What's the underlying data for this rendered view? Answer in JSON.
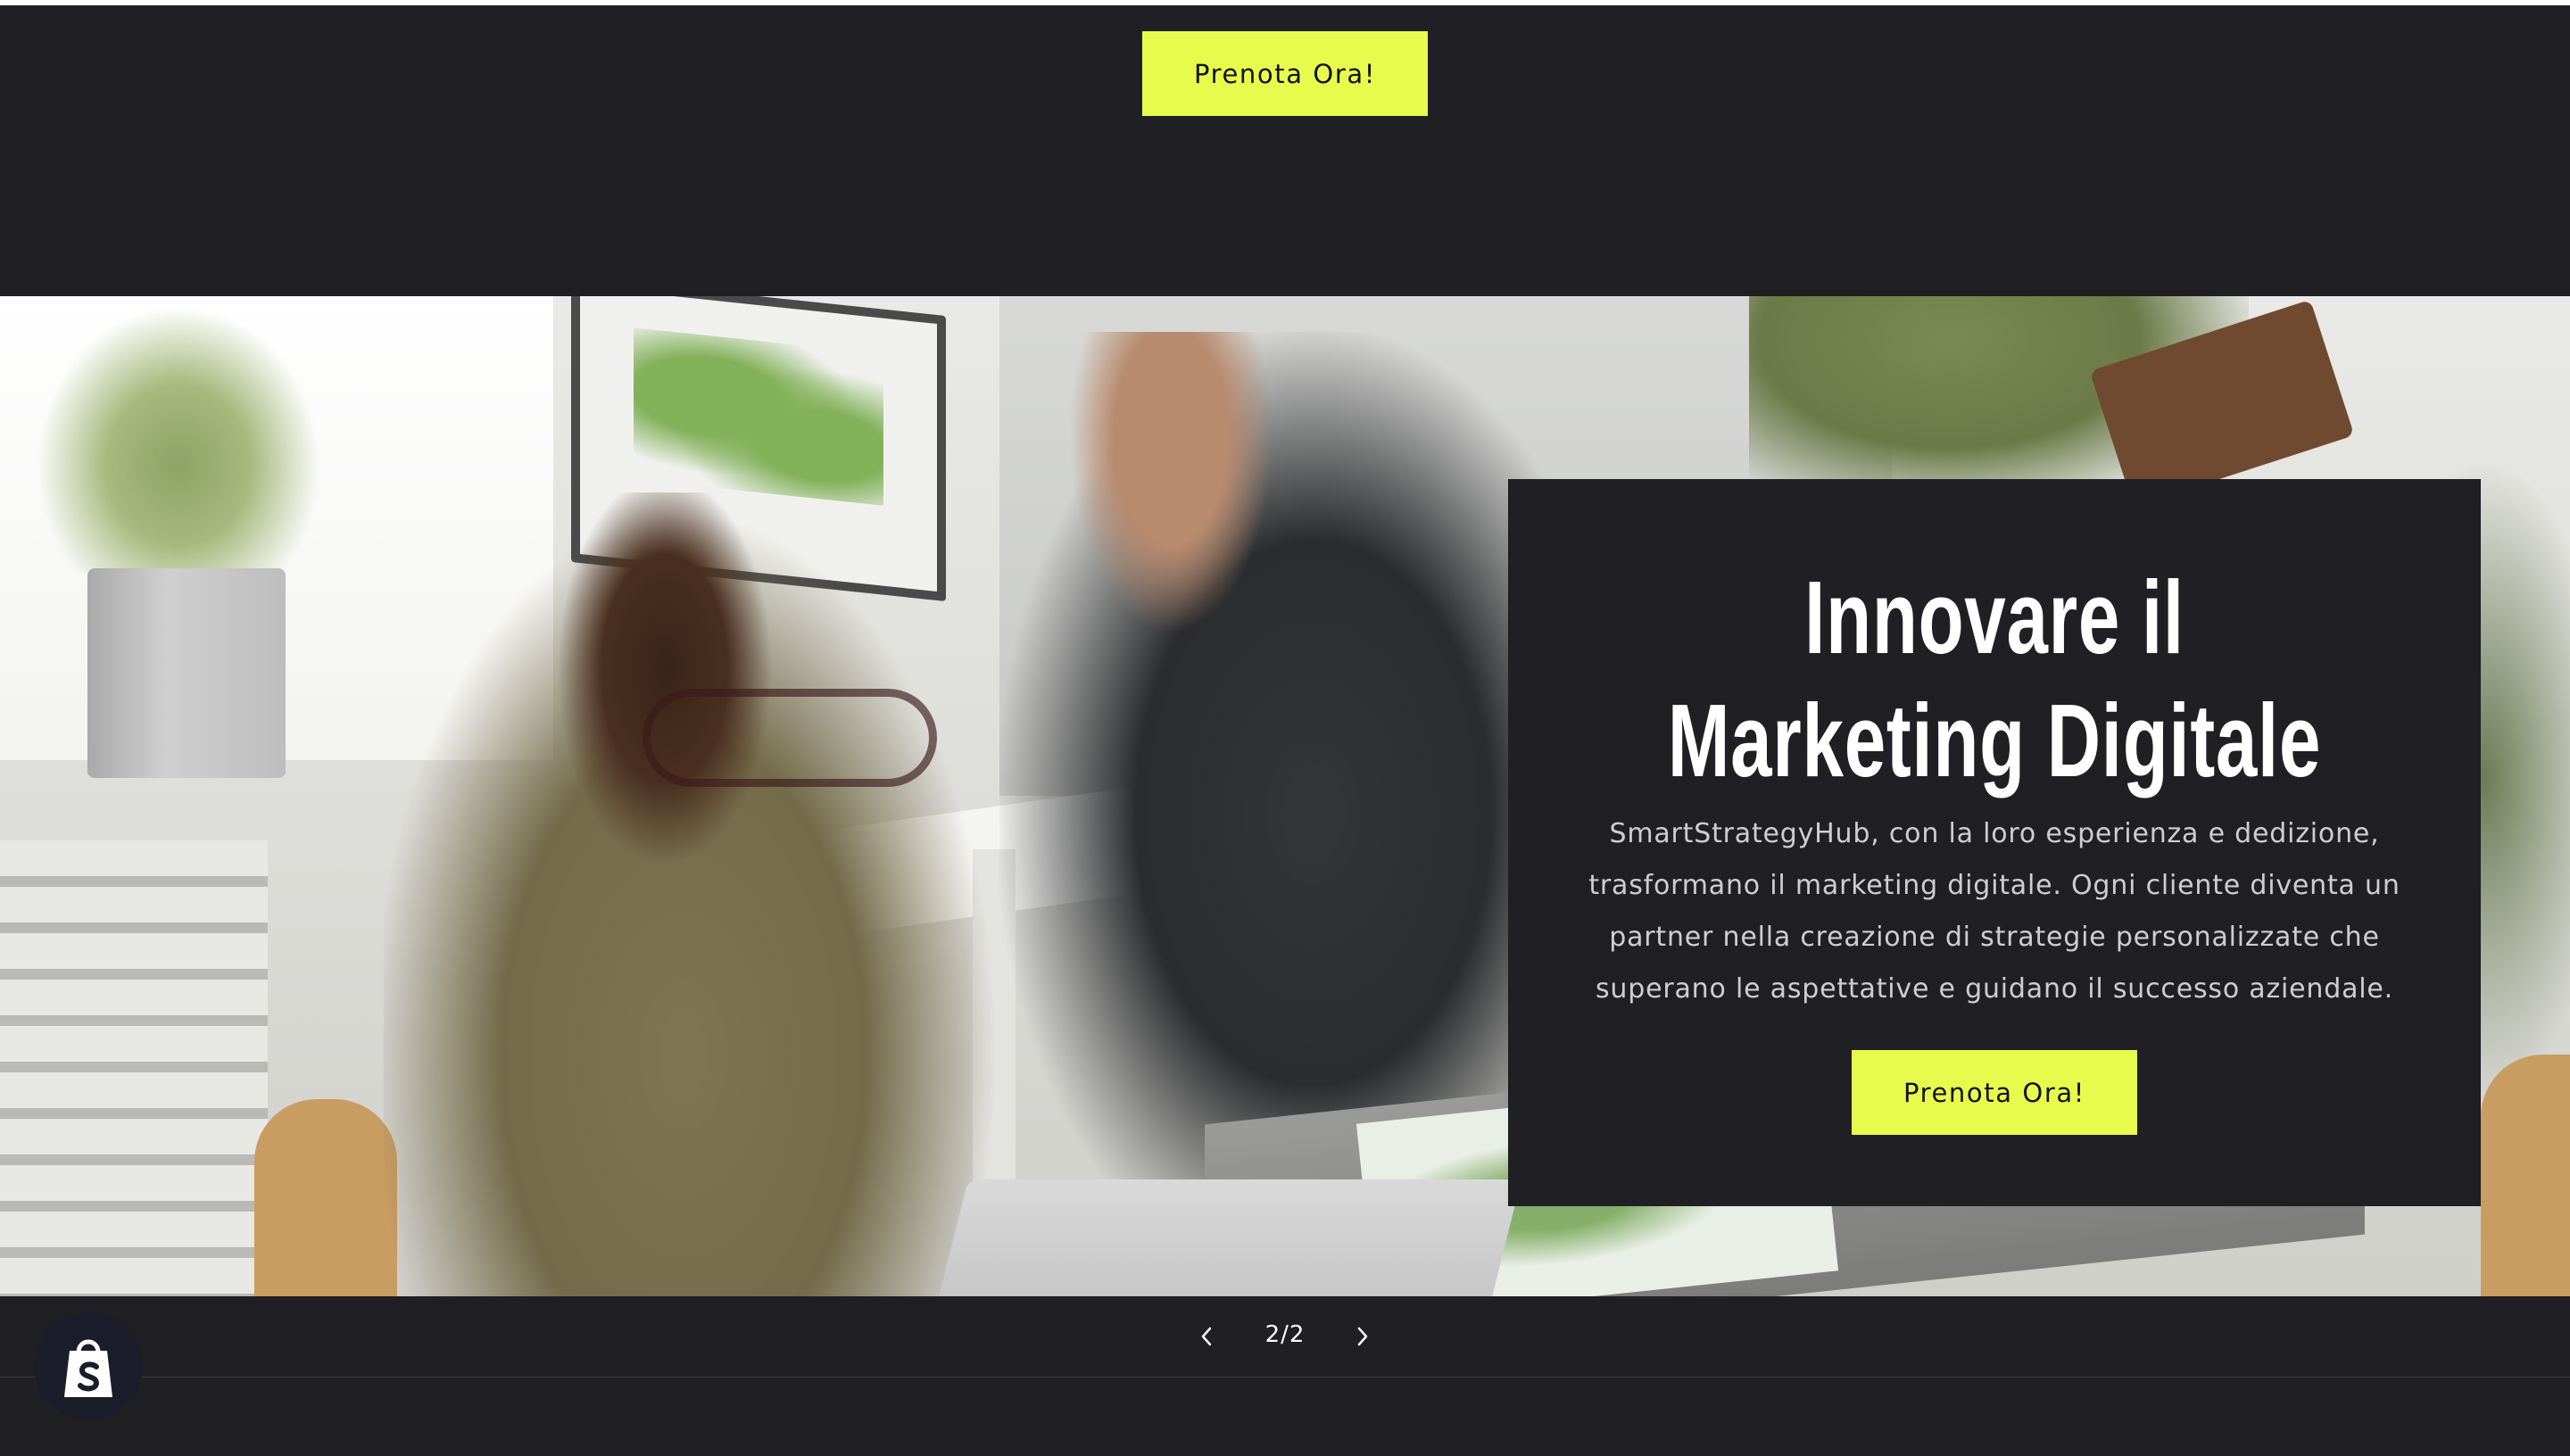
{
  "top_section": {
    "cta_label": "Prenota Ora!"
  },
  "slide": {
    "heading_line1": "Innovare il",
    "heading_line2": "Marketing Digitale",
    "text": "SmartStrategyHub, con la loro esperienza e dedizione, trasformano il marketing digitale. Ogni cliente diventa un partner nella creazione di strategie personalizzate che superano le aspettative e guidano il successo aziendale.",
    "cta_label": "Prenota Ora!",
    "image_alt": "office-team-working-photo"
  },
  "slideshow_controls": {
    "counter": "2/2",
    "prev_icon": "chevron-left-icon",
    "next_icon": "chevron-right-icon"
  },
  "colors": {
    "accent": "#e7fb4d",
    "background": "#202024",
    "text": "#ffffff"
  },
  "badge": {
    "icon": "shopify-bag-icon"
  }
}
